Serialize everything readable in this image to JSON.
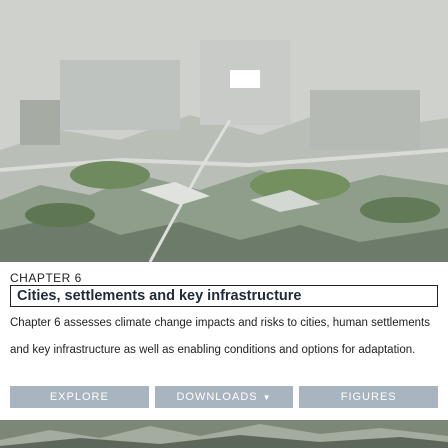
{
  "hero": {
    "image": "aerial-infrastructure-landscape"
  },
  "chapter_label": "CHAPTER 6",
  "title": "Cities, settlements and key infrastructure",
  "description": "Chapter 6 assesses climate change impacts and risks to cities, human settlements and key infrastructure as well as enabling conditions and options for adaptation.",
  "buttons": {
    "explore": "EXPLORE",
    "downloads": "DOWNLOADS",
    "figures": "FIGURES"
  },
  "colors": {
    "button_bg": "#a8b4c0",
    "title_text": "#1e2a3a",
    "border": "#222222"
  }
}
